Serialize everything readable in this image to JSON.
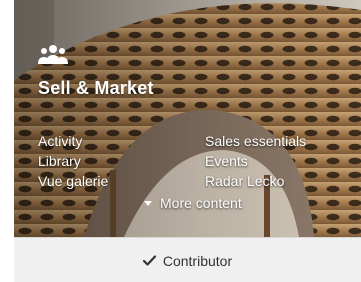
{
  "card": {
    "title": "Sell & Market",
    "icon": "group-icon",
    "links_left": [
      "Activity",
      "Library",
      "Vue galerie"
    ],
    "links_right": [
      "Sales essentials",
      "Events",
      "Radar Lecko"
    ],
    "more_label": "More content",
    "more_icon": "caret-down-icon",
    "footer": {
      "icon": "checkmark-icon",
      "label": "Contributor"
    }
  },
  "colors": {
    "text_on_image": "#ffffff",
    "footer_bg": "#f0f0f0",
    "footer_text": "#333333"
  }
}
